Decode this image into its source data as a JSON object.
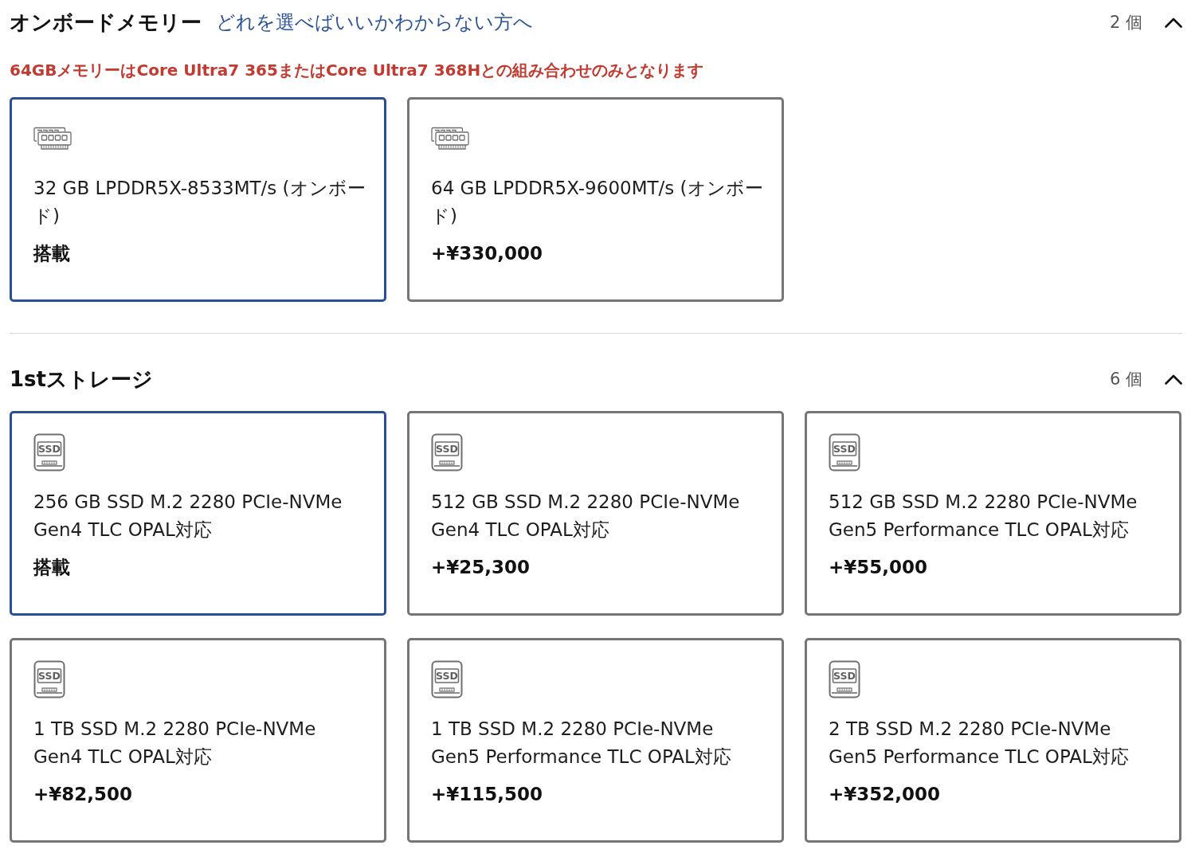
{
  "sections": [
    {
      "title": "オンボードメモリー",
      "help_link": "どれを選べばいいかわからない方へ",
      "count": "2 個",
      "expanded": true,
      "note": "64GBメモリーはCore Ultra7 365またはCore Ultra7 368Hとの組み合わせのみとなります",
      "options": [
        {
          "kind": "memory",
          "name": "32 GB LPDDR5X-8533MT/s (オンボード)",
          "price": "搭載",
          "selected": true
        },
        {
          "kind": "memory",
          "name": "64 GB LPDDR5X-9600MT/s (オンボード)",
          "price": "+¥330,000",
          "selected": false
        }
      ]
    },
    {
      "title": "1stストレージ",
      "count": "6 個",
      "expanded": true,
      "options": [
        {
          "kind": "ssd",
          "icon_label": "SSD",
          "name": "256 GB SSD M.2 2280 PCIe-NVMe Gen4 TLC OPAL対応",
          "price": "搭載",
          "selected": true
        },
        {
          "kind": "ssd",
          "icon_label": "SSD",
          "name": "512 GB SSD M.2 2280 PCIe-NVMe Gen4 TLC OPAL対応",
          "price": "+¥25,300",
          "selected": false
        },
        {
          "kind": "ssd",
          "icon_label": "SSD",
          "name": "512 GB SSD M.2 2280 PCIe-NVMe Gen5 Performance TLC OPAL対応",
          "price": "+¥55,000",
          "selected": false
        },
        {
          "kind": "ssd",
          "icon_label": "SSD",
          "name": "1 TB SSD M.2 2280 PCIe-NVMe Gen4 TLC OPAL対応",
          "price": "+¥82,500",
          "selected": false
        },
        {
          "kind": "ssd",
          "icon_label": "SSD",
          "name": "1 TB SSD M.2 2280 PCIe-NVMe Gen5 Performance TLC OPAL対応",
          "price": "+¥115,500",
          "selected": false
        },
        {
          "kind": "ssd",
          "icon_label": "SSD",
          "name": "2 TB SSD M.2 2280 PCIe-NVMe Gen5 Performance TLC OPAL対応",
          "price": "+¥352,000",
          "selected": false
        }
      ]
    }
  ]
}
